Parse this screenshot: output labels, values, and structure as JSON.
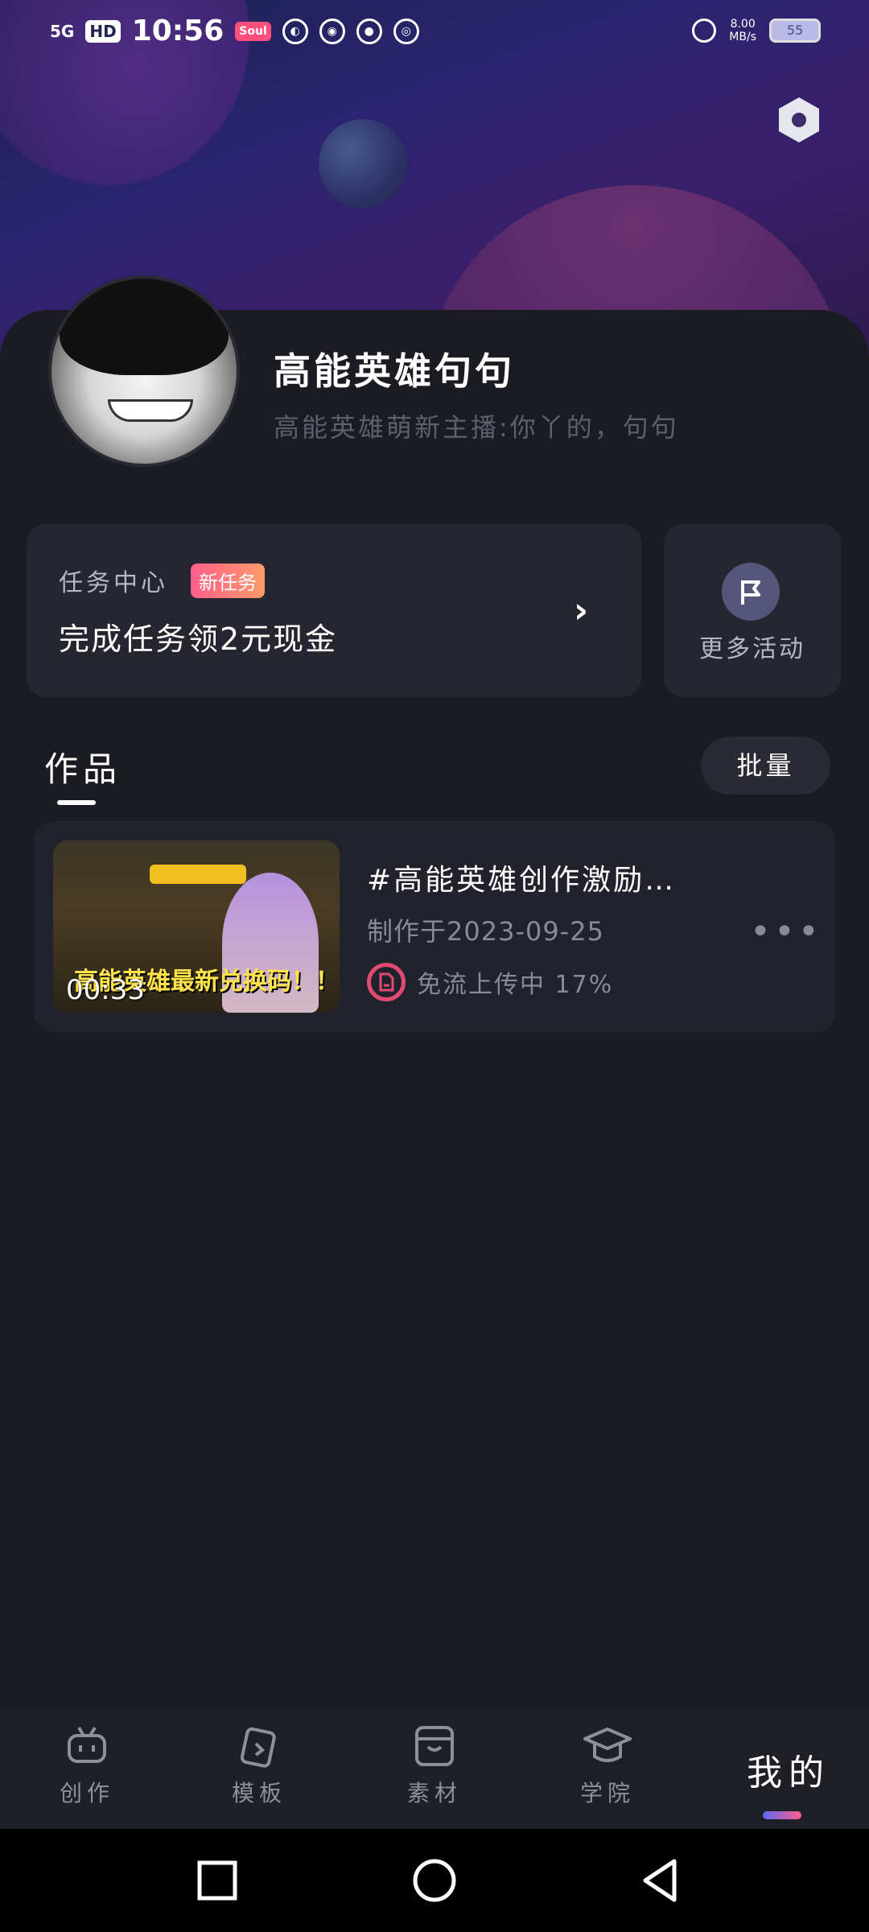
{
  "status_bar": {
    "network": "5G",
    "hd": "HD",
    "time": "10:56",
    "soul_badge": "Soul",
    "speed": "8.00",
    "speed_unit": "MB/s",
    "battery": "55"
  },
  "profile": {
    "username": "高能英雄句句",
    "bio": "高能英雄萌新主播:你丫的，句句"
  },
  "task_card": {
    "label": "任务中心",
    "badge": "新任务",
    "text": "完成任务领2元现金"
  },
  "more_activities": {
    "label": "更多活动"
  },
  "works": {
    "tab_label": "作品",
    "batch_label": "批量",
    "items": [
      {
        "title": "#高能英雄创作激励…",
        "date": "制作于2023-09-25",
        "upload_status": "免流上传中 17%",
        "duration": "00:33",
        "thumbnail_caption": "高能英雄最新兑换码！！！"
      }
    ]
  },
  "bottom_nav": {
    "items": [
      {
        "label": "创作",
        "icon": "create-icon"
      },
      {
        "label": "模板",
        "icon": "template-icon"
      },
      {
        "label": "素材",
        "icon": "material-icon"
      },
      {
        "label": "学院",
        "icon": "academy-icon"
      }
    ],
    "active_label": "我的"
  },
  "colors": {
    "background": "#191920",
    "card": "#262631",
    "accent_pink": "#e14a72",
    "indicator_start": "#5b6af7",
    "indicator_end": "#ff5f8a"
  }
}
